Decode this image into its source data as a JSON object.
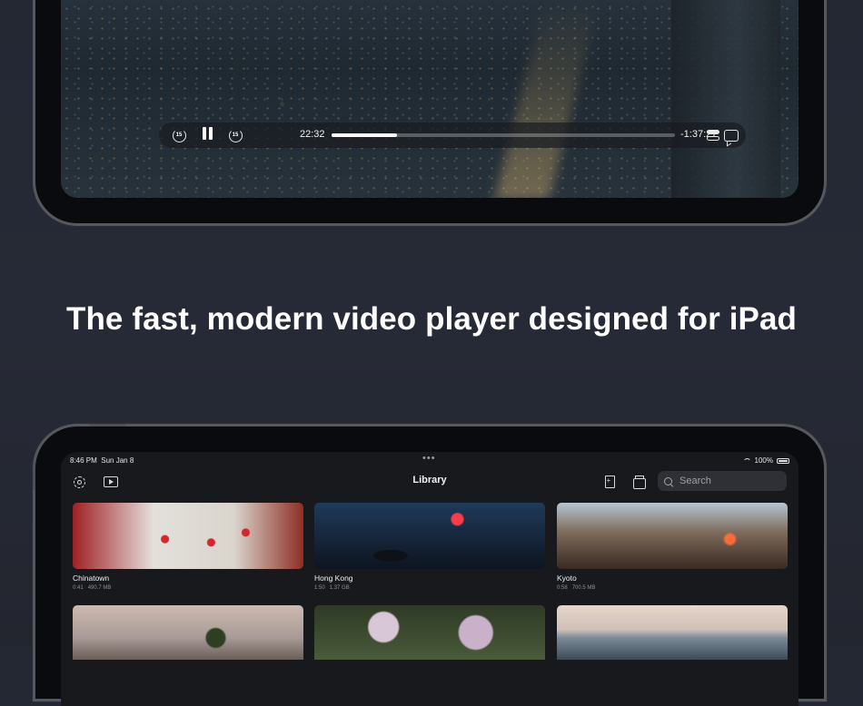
{
  "headline": "The fast, modern video player designed for iPad",
  "player": {
    "skip_back_label": "15",
    "skip_forward_label": "15",
    "elapsed": "22:32",
    "remaining": "-1:37:27",
    "progress": 0.19
  },
  "status_bar": {
    "time": "8:46 PM",
    "date": "Sun Jan 8",
    "multitask_dots": "•••",
    "battery": "100%"
  },
  "library": {
    "title": "Library",
    "search_placeholder": "Search",
    "videos": [
      {
        "title": "Chinatown",
        "duration": "0:41",
        "size": "490.7 MB"
      },
      {
        "title": "Hong Kong",
        "duration": "1:50",
        "size": "1.37 GB"
      },
      {
        "title": "Kyoto",
        "duration": "0:58",
        "size": "700.5 MB"
      }
    ]
  }
}
